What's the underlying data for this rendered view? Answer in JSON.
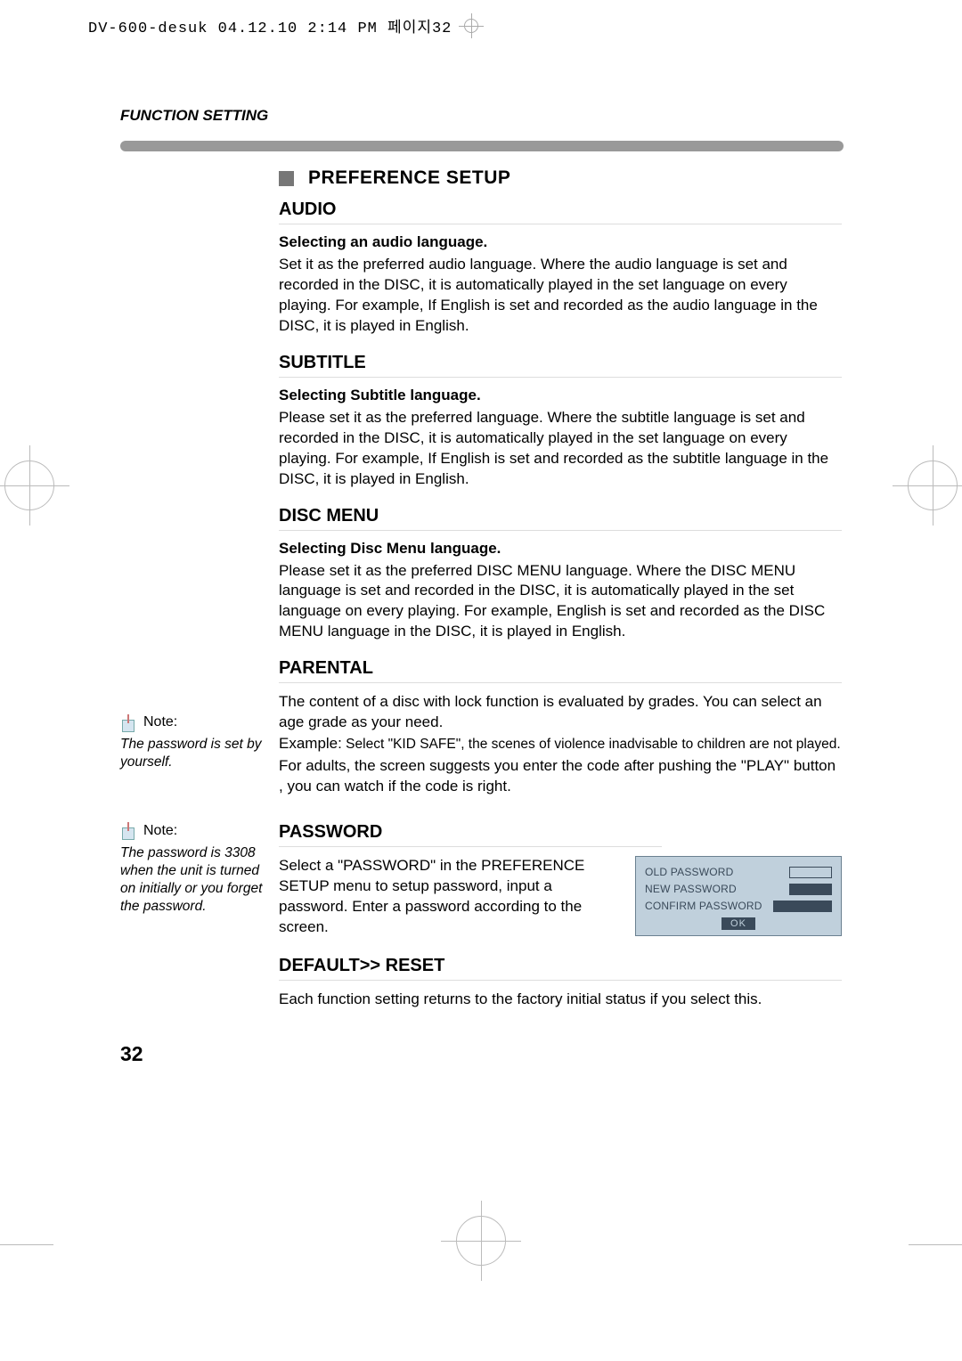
{
  "header": {
    "filename": "DV-600-desuk  04.12.10 2:14 PM  페이지32"
  },
  "sectionLabel": "FUNCTION SETTING",
  "pageNumber": "32",
  "preferenceSetup": {
    "title": "PREFERENCE SETUP"
  },
  "audio": {
    "heading": "AUDIO",
    "bold": "Selecting an audio language.",
    "body": "Set it as the preferred audio language. Where the audio language is set and recorded in the DISC, it is automatically played in the set language on every playing. For example, If English is set and recorded as the audio language in the DISC, it is played in English."
  },
  "subtitle": {
    "heading": "SUBTITLE",
    "bold": "Selecting Subtitle language.",
    "body": "Please set it as the preferred language. Where the subtitle language is set and recorded in the DISC, it is automatically played in the set language on every playing. For example, If English is set and recorded as the subtitle language in the DISC, it is played in English."
  },
  "discMenu": {
    "heading": "DISC MENU",
    "bold": "Selecting Disc Menu language.",
    "body": "Please set it as the preferred DISC MENU language. Where the DISC MENU language is set and recorded in the DISC, it is automatically played in the set language on every playing. For example, English is set and recorded as the DISC MENU language in the DISC, it is played in English."
  },
  "parental": {
    "heading": "PARENTAL",
    "body1": "The content of a disc with lock function is evaluated by grades. You can select an age grade as your need.",
    "exampleLabel": "Example:",
    "exampleText": " Select \"KID SAFE\", the scenes of violence inadvisable to children are not played.",
    "body2": "For adults, the screen suggests you enter the code after pushing the \"PLAY\" button , you can watch if the code is right.",
    "noteLabel": "Note:",
    "noteText": "The password is set by yourself."
  },
  "password": {
    "heading": "PASSWORD",
    "body": "Select a \"PASSWORD\" in the PREFERENCE SETUP menu to setup password, input a password. Enter a password according to the screen.",
    "noteLabel": "Note:",
    "noteText": "The password is 3308 when the unit is turned on initially or you forget the password.",
    "dialog": {
      "old": "OLD PASSWORD",
      "new": "NEW PASSWORD",
      "confirm": "CONFIRM PASSWORD",
      "ok": "OK"
    }
  },
  "defaultReset": {
    "heading": "DEFAULT>> RESET",
    "body": "Each function setting returns to the factory initial status if you select this."
  }
}
